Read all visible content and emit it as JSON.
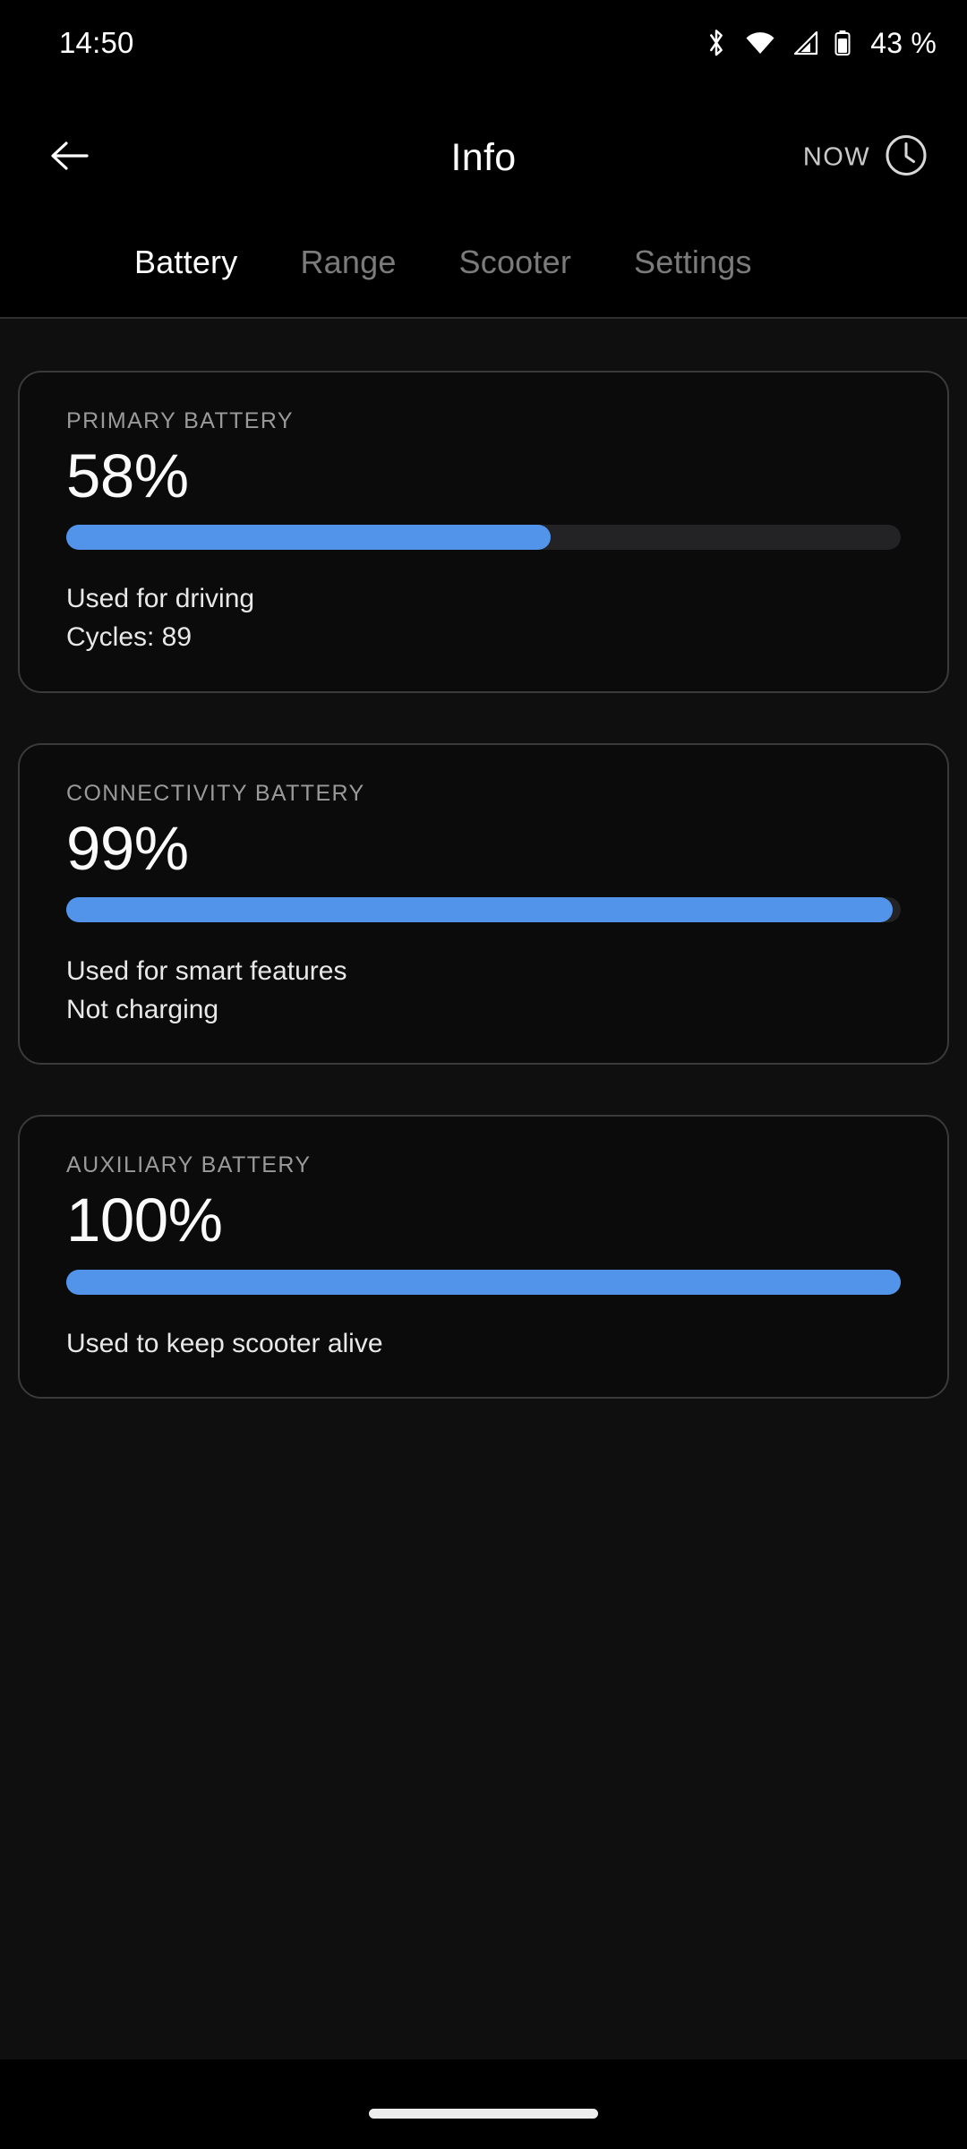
{
  "status_bar": {
    "time": "14:50",
    "battery_percent": "43 %",
    "icons": [
      "bluetooth-icon",
      "wifi-icon",
      "cellular-signal-icon",
      "battery-icon"
    ]
  },
  "app_bar": {
    "back_icon": "arrow-left-icon",
    "title": "Info",
    "now_label": "NOW",
    "clock_icon": "clock-icon"
  },
  "tabs": [
    {
      "label": "Battery",
      "active": true
    },
    {
      "label": "Range",
      "active": false
    },
    {
      "label": "Scooter",
      "active": false
    },
    {
      "label": "Settings",
      "active": false
    }
  ],
  "colors": {
    "accent_blue": "#5294ea",
    "track_gray": "#232325",
    "card_border": "#3a3a3c",
    "content_bg": "#0f0f10",
    "label_gray": "#9a9a9a"
  },
  "cards": [
    {
      "label": "PRIMARY BATTERY",
      "value": "58%",
      "percent": 58,
      "note_1": "Used for driving",
      "note_2": "Cycles: 89"
    },
    {
      "label": "CONNECTIVITY BATTERY",
      "value": "99%",
      "percent": 99,
      "note_1": "Used for smart features",
      "note_2": "Not charging"
    },
    {
      "label": "AUXILIARY BATTERY",
      "value": "100%",
      "percent": 100,
      "note_1": "Used to keep scooter alive",
      "note_2": ""
    }
  ]
}
